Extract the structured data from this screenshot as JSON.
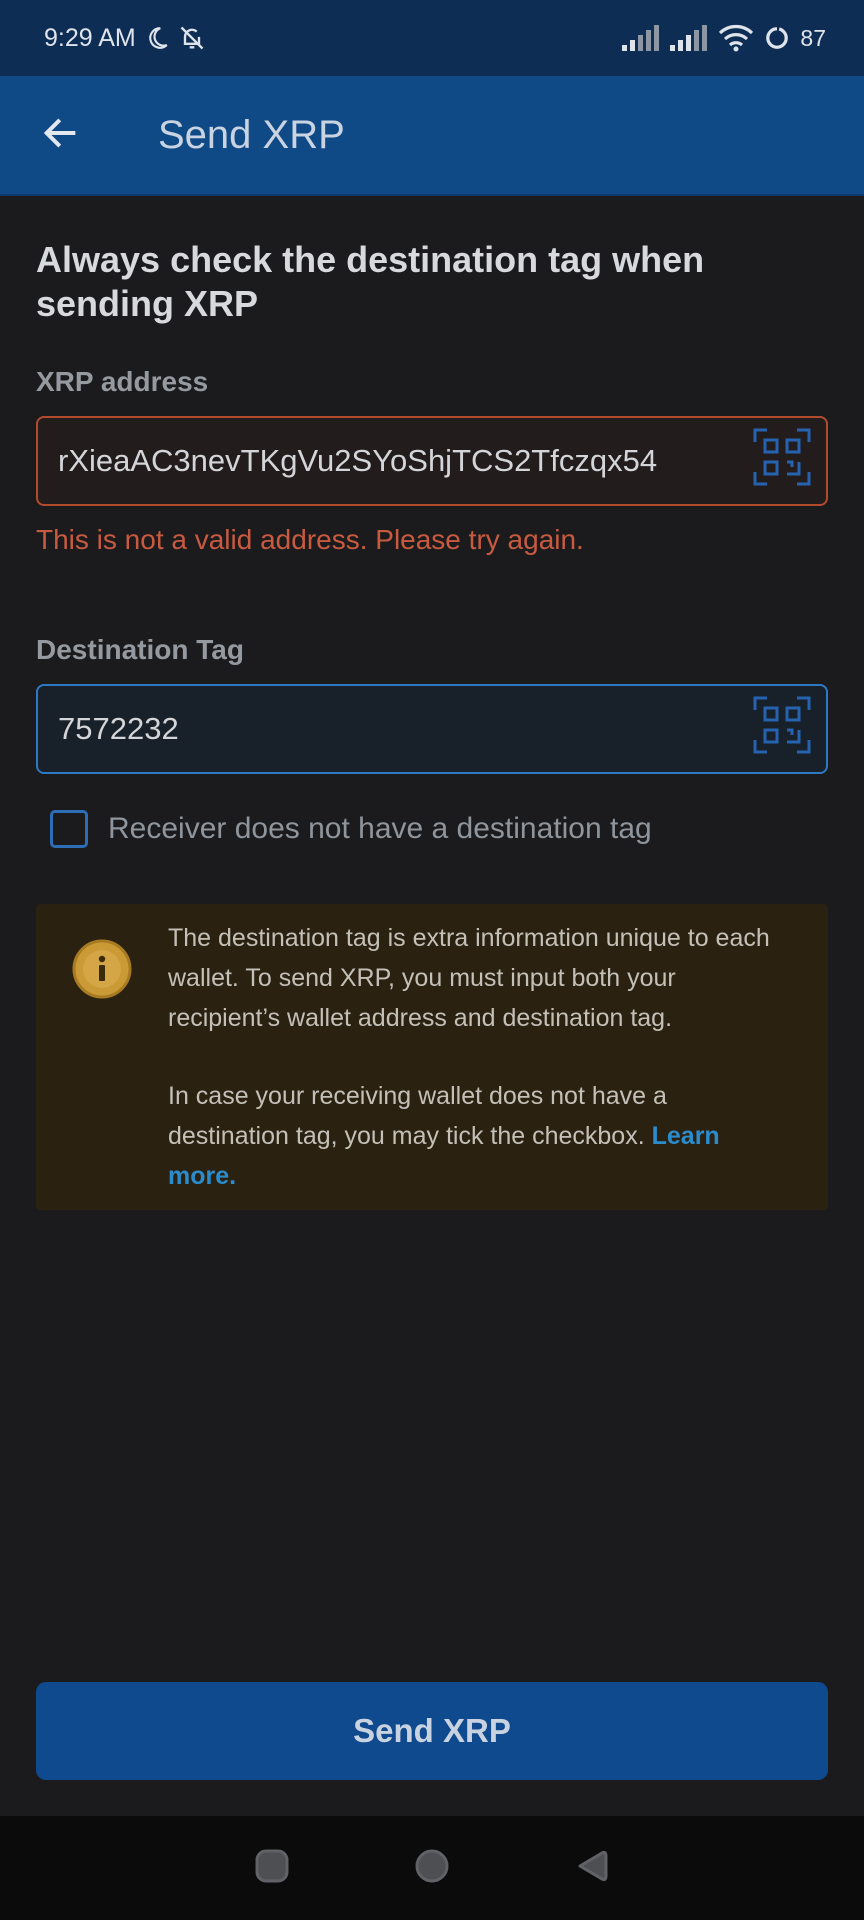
{
  "status_bar": {
    "time": "9:29 AM",
    "battery": "87",
    "icons": [
      "moon-icon",
      "bell-off-icon",
      "signal-icon",
      "signal-icon",
      "wifi-icon",
      "battery-icon"
    ]
  },
  "app_bar": {
    "title": "Send XRP",
    "back_icon": "arrow-left-icon"
  },
  "form": {
    "headline": "Always check the destination tag when sending XRP",
    "address": {
      "label": "XRP address",
      "value": "rXieaAC3nevTKgVu2SYoShjTCS2Tfczqx54",
      "error": "This is not a valid address. Please try again.",
      "scan_icon": "qr-scan-icon"
    },
    "tag": {
      "label": "Destination Tag",
      "value": "7572232",
      "scan_icon": "qr-scan-icon"
    },
    "no_tag_checkbox": {
      "label": "Receiver does not have a destination tag",
      "checked": false
    }
  },
  "info": {
    "icon": "info-icon",
    "paragraph1": "The destination tag is extra information unique to each wallet. To send XRP, you must input both your recipient’s wallet address and destination tag.",
    "paragraph2": "In case your receiving wallet does not have a destination tag, you may tick the checkbox.",
    "learn_more": "Learn more."
  },
  "send_button": {
    "label": "Send XRP"
  },
  "colors": {
    "app_bar": "#0f4a86",
    "status_bar": "#0d2d55",
    "background": "#1b1b1d",
    "error": "#c85a40",
    "accent": "#2f78c2",
    "info_bg": "#2a2111",
    "info_icon": "#c99a36",
    "link": "#2b8ccd"
  },
  "nav_bar": {
    "icons": [
      "recent-apps-icon",
      "home-icon",
      "back-triangle-icon"
    ]
  }
}
